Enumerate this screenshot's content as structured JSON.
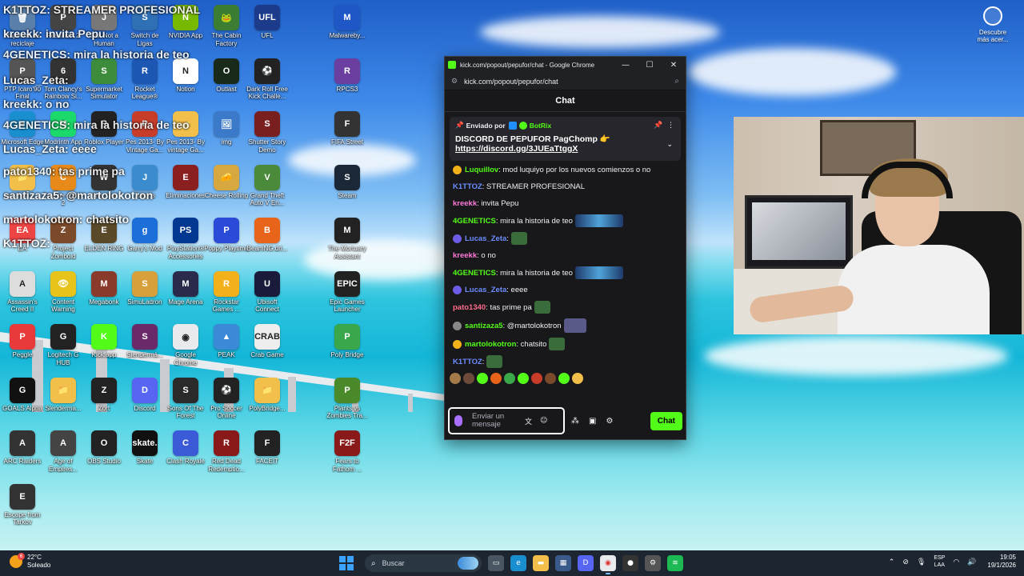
{
  "overlay_chat": [
    {
      "text": "K1TTOZ: STREAMER PROFESIONAL"
    },
    {
      "text": "kreekk: invita Pepu"
    },
    {
      "text": "4GENETICS: mira la historia de teo"
    },
    {
      "text": "Lucas_Zeta:"
    },
    {
      "text": "kreekk: o no"
    },
    {
      "text": "4GENETICS: mira la historia de teo"
    },
    {
      "text": "Lucas_Zeta: eeee"
    },
    {
      "text": "pato1340: tas prime pa"
    },
    {
      "text": "santizaza5: @martolokotron"
    },
    {
      "text": "martolokotron: chatsito"
    },
    {
      "text": "K1TTOZ:"
    }
  ],
  "desktop_icons": [
    {
      "label": "Papelera de reciclaje",
      "color": "#5a7fa8",
      "glyph": "🗑"
    },
    {
      "label": "Pessimist 2",
      "color": "#444",
      "glyph": "P"
    },
    {
      "label": "Just Not a Human",
      "color": "#777",
      "glyph": "J"
    },
    {
      "label": "Switch de Ligas",
      "color": "#2f6fb3",
      "glyph": "S"
    },
    {
      "label": "NVIDIA App",
      "color": "#76b900",
      "glyph": "N"
    },
    {
      "label": "The Cabin Factory",
      "color": "#3c7d34",
      "glyph": "🐸"
    },
    {
      "label": "UFL",
      "color": "#1d3b8b",
      "glyph": "UFL"
    },
    {
      "label": "Malwareby...",
      "color": "#1f58c6",
      "glyph": "M"
    },
    {
      "label": "PTP Icaro'90 Final",
      "color": "#555",
      "glyph": "P"
    },
    {
      "label": "Tom Clancy's Rainbow Si...",
      "color": "#333",
      "glyph": "6"
    },
    {
      "label": "Supermarket Simulator",
      "color": "#3c8c3c",
      "glyph": "S"
    },
    {
      "label": "Rocket League®",
      "color": "#1c57b4",
      "glyph": "R"
    },
    {
      "label": "Notion",
      "color": "#ffffff",
      "glyph": "N"
    },
    {
      "label": "Outlast",
      "color": "#1a2a1a",
      "glyph": "O"
    },
    {
      "label": "Dark Roll Free Kick Challe...",
      "color": "#222",
      "glyph": "⚽"
    },
    {
      "label": "RPCS3",
      "color": "#6b3fa0",
      "glyph": "R"
    },
    {
      "label": "Microsoft Edge",
      "color": "#1a8fd0",
      "glyph": "e"
    },
    {
      "label": "Modrinth App",
      "color": "#1bd96a",
      "glyph": "M"
    },
    {
      "label": "Roblox Player",
      "color": "#222",
      "glyph": "R"
    },
    {
      "label": "Pes 2013- By Vintage Ga...",
      "color": "#c83c2a",
      "glyph": "P"
    },
    {
      "label": "Pes 2013- By vintage Ga...",
      "color": "#f2c04a",
      "glyph": "📁"
    },
    {
      "label": "img",
      "color": "#3a7ac8",
      "glyph": "🖼"
    },
    {
      "label": "Shutter Story Demo",
      "color": "#7a1f1f",
      "glyph": "S"
    },
    {
      "label": "FIFA Street",
      "color": "#333",
      "glyph": "F"
    },
    {
      "label": "rpcs3-v0.0....",
      "color": "#f2c04a",
      "glyph": "📁"
    },
    {
      "label": "Counter-Strike 2",
      "color": "#e88a1a",
      "glyph": "C"
    },
    {
      "label": "Way Out",
      "color": "#333",
      "glyph": "W"
    },
    {
      "label": "Juegos",
      "color": "#3a8ccf",
      "glyph": "J"
    },
    {
      "label": "Eliminaciones",
      "color": "#8a1f1f",
      "glyph": "E"
    },
    {
      "label": "Cheese Rolling",
      "color": "#d8a840",
      "glyph": "🧀"
    },
    {
      "label": "Grand Theft Auto V En...",
      "color": "#4a8a3a",
      "glyph": "V"
    },
    {
      "label": "Steam",
      "color": "#1b2838",
      "glyph": "S"
    },
    {
      "label": "EA",
      "color": "#e44",
      "glyph": "EA"
    },
    {
      "label": "Project Zomboid",
      "color": "#7a4a2a",
      "glyph": "Z"
    },
    {
      "label": "ELDEN RING",
      "color": "#5a4a2a",
      "glyph": "E"
    },
    {
      "label": "Garry's Mod",
      "color": "#1c6fd8",
      "glyph": "g"
    },
    {
      "label": "PlayStation® Accessories",
      "color": "#003791",
      "glyph": "PS"
    },
    {
      "label": "Poppy Playtime",
      "color": "#2a4ad8",
      "glyph": "P"
    },
    {
      "label": "BeamNG.dri...",
      "color": "#e8641a",
      "glyph": "B"
    },
    {
      "label": "The Mortuary Assistant",
      "color": "#222",
      "glyph": "M"
    },
    {
      "label": "Assassin's Creed II",
      "color": "#ddd",
      "glyph": "A"
    },
    {
      "label": "Content Warning",
      "color": "#e8c31a",
      "glyph": "👁"
    },
    {
      "label": "Megabonk",
      "color": "#8a3a2a",
      "glyph": "M"
    },
    {
      "label": "SimuLadron",
      "color": "#d8a03a",
      "glyph": "S"
    },
    {
      "label": "Mage Arena",
      "color": "#2a2a4a",
      "glyph": "M"
    },
    {
      "label": "Rockstar Games ...",
      "color": "#f2b01a",
      "glyph": "R"
    },
    {
      "label": "Ubisoft Connect",
      "color": "#1a1a3a",
      "glyph": "U"
    },
    {
      "label": "Epic Games Launcher",
      "color": "#222",
      "glyph": "EPIC"
    },
    {
      "label": "Peggle",
      "color": "#e83a3a",
      "glyph": "P"
    },
    {
      "label": "Logitech G HUB",
      "color": "#222",
      "glyph": "G"
    },
    {
      "label": "Kick.app",
      "color": "#53fc18",
      "glyph": "K"
    },
    {
      "label": "Slendermá...",
      "color": "#6a2a6a",
      "glyph": "S"
    },
    {
      "label": "Google Chrome",
      "color": "#e8eaed",
      "glyph": "◉"
    },
    {
      "label": "PEAK",
      "color": "#3a8ad8",
      "glyph": "▲"
    },
    {
      "label": "Crab Game",
      "color": "#eee",
      "glyph": "CRAB"
    },
    {
      "label": "Poly Bridge",
      "color": "#3aa84a",
      "glyph": "P"
    },
    {
      "label": "GOALS Alpha",
      "color": "#111",
      "glyph": "G"
    },
    {
      "label": "Slenderma...",
      "color": "#f2c04a",
      "glyph": "📁"
    },
    {
      "label": "Zort",
      "color": "#222",
      "glyph": "Z"
    },
    {
      "label": "Discord",
      "color": "#5865f2",
      "glyph": "D"
    },
    {
      "label": "Sons Of The Forest",
      "color": "#2a2a2a",
      "glyph": "S"
    },
    {
      "label": "Pro Soccer Online",
      "color": "#222",
      "glyph": "⚽"
    },
    {
      "label": "PolyBridge...",
      "color": "#f2c04a",
      "glyph": "📁"
    },
    {
      "label": "Plants vs Zombies Tra...",
      "color": "#4a8a2a",
      "glyph": "P"
    },
    {
      "label": "ARC Raiders",
      "color": "#333",
      "glyph": "A"
    },
    {
      "label": "Age of Empires...",
      "color": "#444",
      "glyph": "A"
    },
    {
      "label": "OBS Studio",
      "color": "#222",
      "glyph": "O"
    },
    {
      "label": "Skate",
      "color": "#111",
      "glyph": "skate."
    },
    {
      "label": "Clash Royale",
      "color": "#3a5ad8",
      "glyph": "C"
    },
    {
      "label": "Red Dead Redemptio...",
      "color": "#8a1a1a",
      "glyph": "R"
    },
    {
      "label": "FACEIT",
      "color": "#222",
      "glyph": "F"
    },
    {
      "label": "Fears to Fathom ...",
      "color": "#8a1a1a",
      "glyph": "F2F"
    },
    {
      "label": "Escape from Tarkov",
      "color": "#333",
      "glyph": "E"
    }
  ],
  "discover": {
    "label": "Descubre más acer..."
  },
  "browser": {
    "title": "kick.com/popout/pepufor/chat - Google Chrome",
    "url": "kick.com/popout/pepufor/chat",
    "minimize": "—",
    "maximize": "☐",
    "close": "✕"
  },
  "chat": {
    "header": "Chat",
    "pinned": {
      "sent_by": "Enviado por",
      "bot_name": "BotRix",
      "message": "DISCORD DE PEPUFOR PagChomp 👉",
      "link": "https://discord.gg/3JUEaTtggX"
    },
    "messages": [
      {
        "user": "Luquillov",
        "color": "#53fc18",
        "text": ": mod luquiyo por los nuevos comienzos o no",
        "badge": "#f2b01a",
        "emote": ""
      },
      {
        "user": "K1TTOZ",
        "color": "#6c8cff",
        "text": ": STREAMER PROFESIONAL",
        "badge": "",
        "emote": ""
      },
      {
        "user": "kreekk",
        "color": "#ff7ad9",
        "text": ": invita Pepu",
        "badge": "",
        "emote": ""
      },
      {
        "user": "4GENETICS",
        "color": "#53fc18",
        "text": ": mira la historia de teo",
        "badge": "",
        "emote": "wide"
      },
      {
        "user": "Lucas_Zeta",
        "color": "#6c8cff",
        "text": ":",
        "badge": "#6c5ce7",
        "emote": "sm"
      },
      {
        "user": "kreekk",
        "color": "#ff7ad9",
        "text": ": o no",
        "badge": "",
        "emote": ""
      },
      {
        "user": "4GENETICS",
        "color": "#53fc18",
        "text": ": mira la historia de teo",
        "badge": "",
        "emote": "wide"
      },
      {
        "user": "Lucas_Zeta",
        "color": "#6c8cff",
        "text": ": eeee",
        "badge": "#6c5ce7",
        "emote": ""
      },
      {
        "user": "pato1340",
        "color": "#ff6b8a",
        "text": ": tas prime pa",
        "badge": "",
        "emote": "sm"
      },
      {
        "user": "santizaza5",
        "color": "#53fc18",
        "text": ": @martolokotron",
        "badge": "#888888",
        "emote": "mid"
      },
      {
        "user": "martolokotron",
        "color": "#53fc18",
        "text": ": chatsito",
        "badge": "#f2b01a",
        "emote": "sm"
      },
      {
        "user": "K1TTOZ",
        "color": "#6c8cff",
        "text": ":",
        "badge": "",
        "emote": "sm"
      }
    ],
    "input_placeholder": "Enviar un mensaje",
    "send_label": "Chat"
  },
  "taskbar": {
    "weather_temp": "22°C",
    "weather_desc": "Soleado",
    "weather_badge": "6",
    "search_placeholder": "Buscar",
    "lang_top": "ESP",
    "lang_bottom": "LAA",
    "time": "19:05",
    "date": "19/1/2026"
  }
}
